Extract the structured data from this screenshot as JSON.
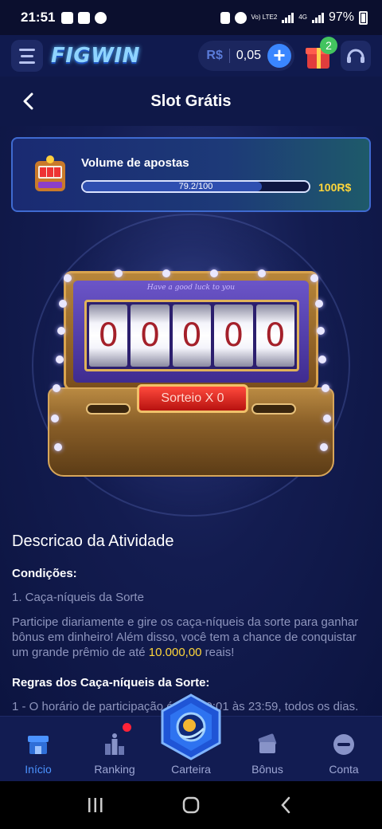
{
  "status_bar": {
    "time": "21:51",
    "network": "Vo) LTE2",
    "signal_type": "4G",
    "battery": "97%"
  },
  "header": {
    "logo_text": "FIGWIN",
    "currency": "R$",
    "balance": "0,05",
    "gift_badge": "2"
  },
  "page": {
    "title": "Slot Grátis"
  },
  "bet_volume": {
    "label": "Volume de apostas",
    "progress_text": "79.2/100",
    "progress_fraction": 0.792,
    "target": "100R$"
  },
  "slot_machine": {
    "tagline": "Have a good luck to you",
    "reels": [
      "0",
      "0",
      "0",
      "0",
      "0"
    ],
    "draw_button": "Sorteio X 0"
  },
  "description": {
    "title": "Descricao da Atividade",
    "conditions_heading": "Condições:",
    "item1": "1. Caça-níqueis da Sorte",
    "paragraph_part1": "Participe diariamente e gire os caça-níqueis da sorte para ganhar bônus em dinheiro! Além disso, você tem a chance de conquistar um grande prêmio de até ",
    "paragraph_highlight": "10.000,00",
    "paragraph_part2": " reais!",
    "rules_heading": "Regras dos Caça-níqueis da Sorte:",
    "rule1": "1 - O horário de participação é das 00:01 às 23:59, todos os dias."
  },
  "bottom_nav": [
    {
      "label": "Início",
      "active": true
    },
    {
      "label": "Ranking",
      "active": false
    },
    {
      "label": "Carteira",
      "active": false
    },
    {
      "label": "Bônus",
      "active": false
    },
    {
      "label": "Conta",
      "active": false
    }
  ],
  "colors": {
    "accent": "#3a86ff",
    "highlight": "#ffd63a",
    "background": "#0d1642",
    "badge_green": "#43c45f"
  }
}
